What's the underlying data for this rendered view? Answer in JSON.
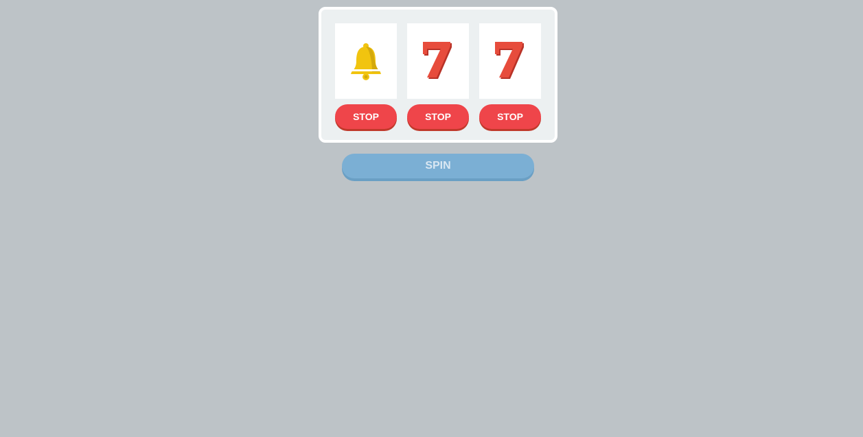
{
  "reels": [
    {
      "symbol": "bell-icon",
      "text": "",
      "stop_label": "STOP"
    },
    {
      "symbol": "seven-icon",
      "text": "7",
      "stop_label": "STOP"
    },
    {
      "symbol": "seven-icon",
      "text": "7",
      "stop_label": "STOP"
    }
  ],
  "spin_label": "SPIN",
  "colors": {
    "background": "#bdc3c7",
    "frame": "#ecf0f1",
    "stop_button": "#ef454a",
    "spin_button": "#7bafd4",
    "bell": "#f1c40f",
    "seven": "#e74c3c"
  }
}
